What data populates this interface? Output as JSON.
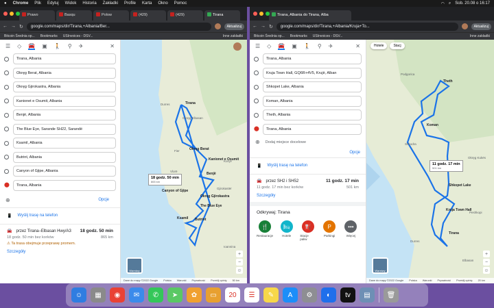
{
  "menubar": {
    "app": "Chrome",
    "items": [
      "Plik",
      "Edytuj",
      "Widok",
      "Historia",
      "Zakładki",
      "Profile",
      "Karta",
      "Okno",
      "Pomoc"
    ],
    "datetime": "Sob. 20.08 o 16:17"
  },
  "left": {
    "tabs": [
      "Prawo",
      "Basqu",
      "Polow",
      "(429)",
      "(429)",
      "Tirana"
    ],
    "url": "google.com/maps/dir/Tirana,+Albania/Ber...",
    "update": "Aktualizuj",
    "bookmarks": [
      "Bitcoin Średnia op...",
      "Bookmarks",
      "USInvoices - DSV...",
      "Inne zakładki"
    ],
    "stops": [
      "Tirana, Albania",
      "Okręg Berat, Albania",
      "Okręg Gjirokastra, Albania",
      "Kanionet e Osumit, Albania",
      "Benjë, Albania",
      "The Blue Eye, Sarande SH22, Sarandë",
      "Ksamil, Albania",
      "Butrint, Albania",
      "Canyon of Gjipe, Albania",
      "Tirana, Albania"
    ],
    "options": "Opcje",
    "send": "Wyślij trasę na telefon",
    "route": {
      "via": "przez Tirana–Elbasan Hwy/A3",
      "time": "18 godz. 50 min",
      "sub": "18 godz. 50 min bez korków",
      "km": "865 km",
      "warn": "Ta trasa obejmuje przeprawę promem.",
      "details": "Szczegóły"
    },
    "map": {
      "bubble_time": "18 godz. 50 min",
      "bubble_km": "865 km",
      "labels": [
        "Tirana",
        "Okręg Elbasan",
        "Durres",
        "Okręg Berat",
        "Kanionet e Osumit",
        "Benjë",
        "Canyon of Gjipe",
        "Okręg Gjirokastra",
        "The Blue Eye",
        "Ksamil",
        "Butrint",
        "Vlorë",
        "Gjirokastër",
        "Fier",
        "Korçë",
        "Ioannina"
      ],
      "layers": "Warstwy",
      "footer": [
        "Dane do mapy ©2022 Google",
        "Polska",
        "Warunki",
        "Prywatność",
        "Prześlij opinię",
        "50 km"
      ]
    }
  },
  "right": {
    "tabs": [
      "Tirana, Albania do Tirana, Alba"
    ],
    "url": "google.com/maps/dir/Tirana,+Albania/Kruja+To...",
    "update": "Aktualizuj",
    "bookmarks": [
      "Bitcoin Średnia op...",
      "Bookmarks",
      "USInvoices - DSV...",
      "Inne zakładki"
    ],
    "stops": [
      "Tirana, Albania",
      "Kruja Town Hall, GQ6R+4V5, Krujë, Alban",
      "Shkopet Lake, Albania",
      "Koman, Albania",
      "Theth, Albania",
      "Tirana, Albania"
    ],
    "add": "Dodaj miejsce docelowe",
    "options": "Opcje",
    "send": "Wyślij trasę na telefon",
    "route": {
      "via": "przez SH2 i SH52",
      "time": "11 godz. 17 min",
      "sub": "11 godz. 17 min bez korków",
      "km": "501 km",
      "details": "Szczegóły"
    },
    "explore": {
      "title": "Odkrywaj: Tirana",
      "cats": [
        {
          "label": "Restauracje",
          "color": "#188038",
          "icon": "🍴"
        },
        {
          "label": "Hotele",
          "color": "#12b5cb",
          "icon": "🛏"
        },
        {
          "label": "Stacje paliw",
          "color": "#d93025",
          "icon": "⛽"
        },
        {
          "label": "Parkingi",
          "color": "#e37400",
          "icon": "P"
        },
        {
          "label": "Więcej",
          "color": "#5f6368",
          "icon": "•••"
        }
      ]
    },
    "map": {
      "chips": [
        "Hotele",
        "Stacj"
      ],
      "bubble_time": "11 godz. 17 min",
      "bubble_km": "501 km",
      "labels": [
        "Theth",
        "Koman",
        "Shkopet Lake",
        "Kruja Town Hall",
        "Tirana",
        "Shkodra",
        "Podgorica",
        "Durres",
        "Peshkopi",
        "Elbasan",
        "Okręg Kukës"
      ],
      "layers": "Warstwy",
      "footer": [
        "Dane do mapy ©2022 Google",
        "Polska",
        "Warunki",
        "Prywatność",
        "Prześlij opinię",
        "20 km"
      ]
    }
  },
  "dock": {
    "items": [
      {
        "name": "finder",
        "color": "#2f7de1",
        "glyph": "☺"
      },
      {
        "name": "launchpad",
        "color": "#8a8a8a",
        "glyph": "▦"
      },
      {
        "name": "chrome",
        "color": "#e94235",
        "glyph": "◉"
      },
      {
        "name": "mail",
        "color": "#3b8beb",
        "glyph": "✉"
      },
      {
        "name": "messages",
        "color": "#34c759",
        "glyph": "✆"
      },
      {
        "name": "maps",
        "color": "#5ac864",
        "glyph": "➤"
      },
      {
        "name": "photos",
        "color": "#f0a030",
        "glyph": "✿"
      },
      {
        "name": "notes-wallet",
        "color": "#e8a030",
        "glyph": "▭"
      },
      {
        "name": "calendar",
        "color": "#ffffff",
        "glyph": "20"
      },
      {
        "name": "reminders",
        "color": "#ffffff",
        "glyph": "☰"
      },
      {
        "name": "notes",
        "color": "#f7d74a",
        "glyph": "✎"
      },
      {
        "name": "app-store",
        "color": "#1c8ef9",
        "glyph": "A"
      },
      {
        "name": "settings",
        "color": "#8e8e93",
        "glyph": "⚙"
      },
      {
        "name": "edge",
        "color": "#1f6feb",
        "glyph": "◐"
      },
      {
        "name": "apple-tv",
        "color": "#111111",
        "glyph": "tv"
      },
      {
        "name": "preview",
        "color": "#6e8fb5",
        "glyph": "▤"
      },
      {
        "name": "trash",
        "color": "#9a9a9a",
        "glyph": "🗑"
      }
    ]
  }
}
